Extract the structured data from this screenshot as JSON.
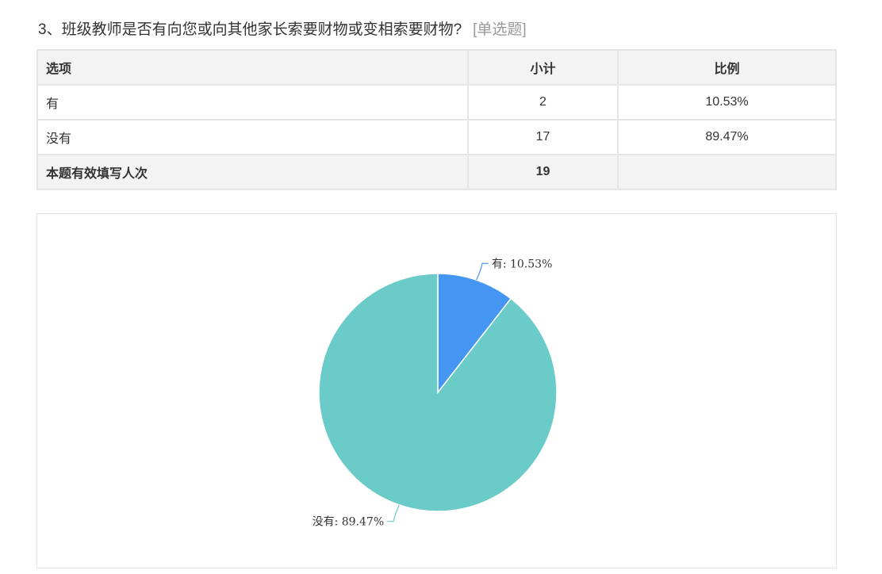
{
  "question": {
    "title": "3、班级教师是否有向您或向其他家长索要财物或变相索要财物?",
    "type_label": "[单选题]"
  },
  "table": {
    "headers": [
      "选项",
      "小计",
      "比例"
    ],
    "rows": [
      {
        "option": "有",
        "count": "2",
        "percent": "10.53%"
      },
      {
        "option": "没有",
        "count": "17",
        "percent": "89.47%"
      }
    ],
    "total": {
      "label": "本题有效填写人次",
      "count": "19",
      "percent": ""
    }
  },
  "chart_data": {
    "type": "pie",
    "categories": [
      "有",
      "没有"
    ],
    "values": [
      2,
      17
    ],
    "labels": [
      "有: 10.53%",
      "没有: 89.47%"
    ],
    "colors": [
      "#4596f3",
      "#6acbc9"
    ],
    "title": ""
  }
}
